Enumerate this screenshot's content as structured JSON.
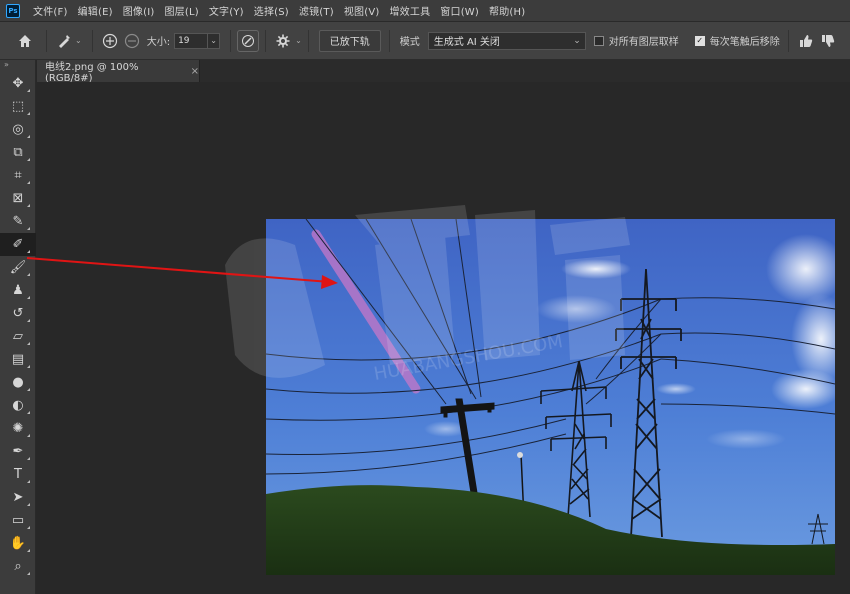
{
  "app": {
    "logo": "Ps"
  },
  "menu": [
    "文件(F)",
    "编辑(E)",
    "图像(I)",
    "图层(L)",
    "文字(Y)",
    "选择(S)",
    "滤镜(T)",
    "视图(V)",
    "增效工具",
    "窗口(W)",
    "帮助(H)"
  ],
  "options": {
    "size_label": "大小:",
    "size_value": "19",
    "content_button": "已放下轨",
    "mode_label": "模式",
    "mode_value": "生成式 AI 关闭",
    "sample_all_label": "对所有图层取样",
    "remove_each_label": "每次笔触后移除"
  },
  "document": {
    "tab_title": "电线2.png @ 100%(RGB/8#)",
    "close": "×"
  },
  "watermark": {
    "text": "HUABANGSHOU.COM"
  },
  "colors": {
    "arrow": "#e01414",
    "active_tool_bg": "#1f1f1f"
  },
  "tools": [
    {
      "name": "move-tool",
      "glyph": "✥"
    },
    {
      "name": "marquee-tool",
      "glyph": "⬚"
    },
    {
      "name": "lasso-tool",
      "glyph": "◎"
    },
    {
      "name": "object-select-tool",
      "glyph": "⧉"
    },
    {
      "name": "crop-tool",
      "glyph": "⌗"
    },
    {
      "name": "frame-tool",
      "glyph": "⊠"
    },
    {
      "name": "eyedropper-tool",
      "glyph": "✎"
    },
    {
      "name": "remove-tool",
      "glyph": "✐",
      "active": true
    },
    {
      "name": "brush-tool",
      "glyph": "🖌"
    },
    {
      "name": "stamp-tool",
      "glyph": "♟"
    },
    {
      "name": "history-brush-tool",
      "glyph": "↺"
    },
    {
      "name": "eraser-tool",
      "glyph": "▱"
    },
    {
      "name": "gradient-tool",
      "glyph": "▤"
    },
    {
      "name": "blur-tool",
      "glyph": "●"
    },
    {
      "name": "dodge-tool",
      "glyph": "◐"
    },
    {
      "name": "sponge-tool",
      "glyph": "✺"
    },
    {
      "name": "pen-tool",
      "glyph": "✒"
    },
    {
      "name": "type-tool",
      "glyph": "T"
    },
    {
      "name": "path-select-tool",
      "glyph": "➤"
    },
    {
      "name": "shape-tool",
      "glyph": "▭"
    },
    {
      "name": "hand-tool",
      "glyph": "✋"
    },
    {
      "name": "zoom-tool",
      "glyph": "⌕"
    }
  ]
}
